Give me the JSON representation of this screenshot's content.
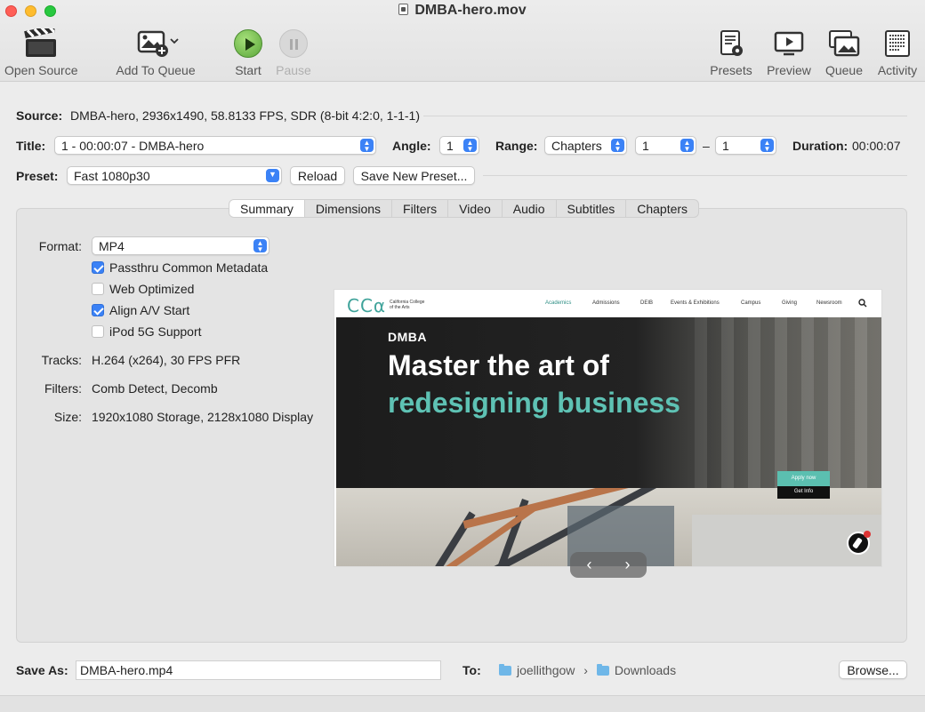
{
  "window": {
    "title": "DMBA-hero.mov"
  },
  "toolbar": {
    "open_source": "Open Source",
    "add_to_queue": "Add To Queue",
    "start": "Start",
    "pause": "Pause",
    "presets": "Presets",
    "preview": "Preview",
    "queue": "Queue",
    "activity": "Activity"
  },
  "source": {
    "label": "Source:",
    "value": "DMBA-hero, 2936x1490, 58.8133 FPS, SDR (8-bit 4:2:0, 1-1-1)"
  },
  "title_row": {
    "label": "Title:",
    "value": "1 - 00:00:07 - DMBA-hero",
    "angle_label": "Angle:",
    "angle_value": "1",
    "range_label": "Range:",
    "range_type": "Chapters",
    "range_start": "1",
    "range_dash": "–",
    "range_end": "1",
    "duration_label": "Duration:",
    "duration_value": "00:00:07"
  },
  "preset_row": {
    "label": "Preset:",
    "value": "Fast 1080p30",
    "reload": "Reload",
    "save_new": "Save New Preset..."
  },
  "tabs": [
    "Summary",
    "Dimensions",
    "Filters",
    "Video",
    "Audio",
    "Subtitles",
    "Chapters"
  ],
  "summary": {
    "format_label": "Format:",
    "format_value": "MP4",
    "options": [
      {
        "label": "Passthru Common Metadata",
        "checked": true
      },
      {
        "label": "Web Optimized",
        "checked": false
      },
      {
        "label": "Align A/V Start",
        "checked": true
      },
      {
        "label": "iPod 5G Support",
        "checked": false
      }
    ],
    "tracks_label": "Tracks:",
    "tracks_value": "H.264 (x264), 30 FPS PFR",
    "filters_label": "Filters:",
    "filters_value": "Comb Detect, Decomb",
    "size_label": "Size:",
    "size_value": "1920x1080 Storage, 2128x1080 Display"
  },
  "preview_frame": {
    "logo": "CCα",
    "logo_sub_1": "California College",
    "logo_sub_2": "of the Arts",
    "menu": [
      "Academics",
      "Admissions",
      "DEIB",
      "Events & Exhibitions",
      "Campus",
      "Giving",
      "Newsroom"
    ],
    "brand": "DMBA",
    "headline_1": "Master the art of",
    "headline_2": "redesigning business",
    "apply": "Apply now",
    "get_info": "Get Info",
    "accent_color": "#5ec2b4"
  },
  "pager": {
    "prev": "‹",
    "next": "›"
  },
  "footer": {
    "save_as_label": "Save As:",
    "save_as_value": "DMBA-hero.mp4",
    "to_label": "To:",
    "path_user": "joellithgow",
    "path_sep": "›",
    "path_folder": "Downloads",
    "browse": "Browse..."
  }
}
